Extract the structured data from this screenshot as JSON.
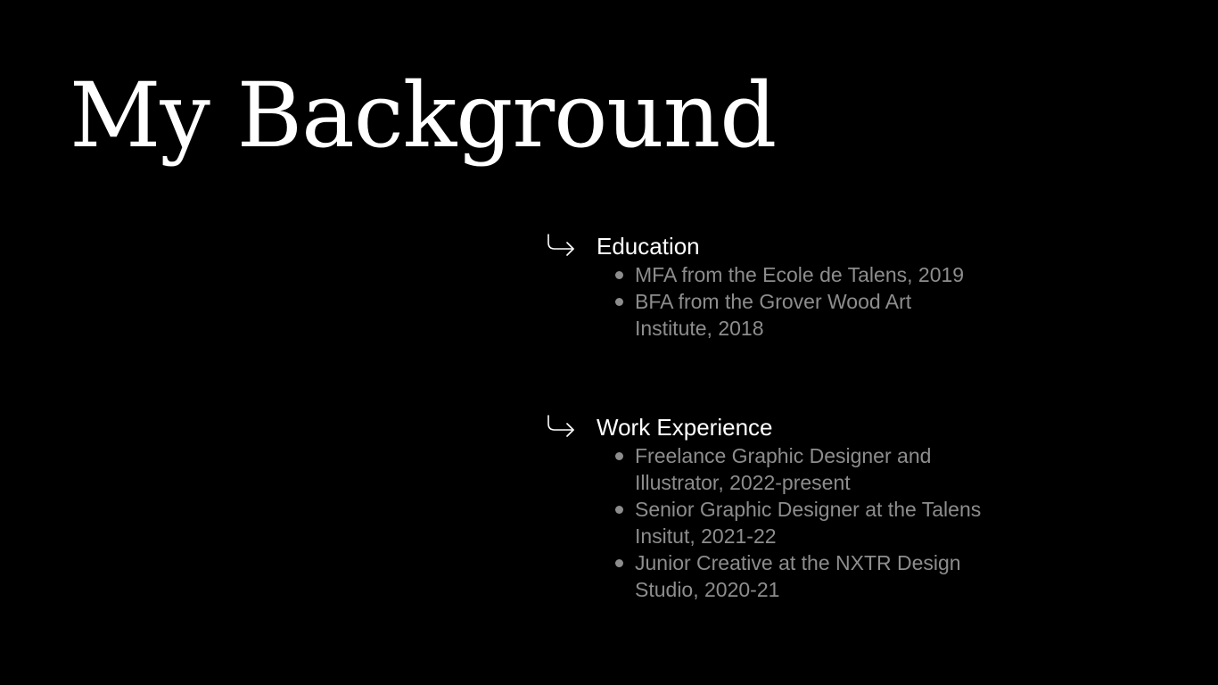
{
  "title": "My Background",
  "sections": [
    {
      "heading": "Education",
      "icon": "arrow-down-right-icon",
      "items": [
        "MFA from the Ecole de Talens, 2019",
        "BFA from the Grover Wood Art Institute, 2018"
      ]
    },
    {
      "heading": "Work Experience",
      "icon": "arrow-down-right-icon",
      "items": [
        "Freelance Graphic Designer and Illustrator, 2022-present",
        "Senior Graphic Designer at the Talens Insitut, 2021-22",
        "Junior Creative at the NXTR Design Studio, 2020-21"
      ]
    }
  ],
  "colors": {
    "background": "#000000",
    "title": "#ffffff",
    "heading": "#ffffff",
    "item_text": "#8d8d8d"
  }
}
